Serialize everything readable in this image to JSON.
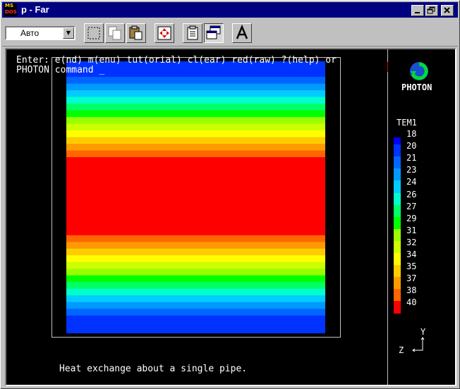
{
  "window": {
    "title": "p - Far",
    "icon_top": "MS",
    "icon_bottom": "DOS",
    "buttons": [
      "minimize-icon",
      "restore-icon",
      "close-icon"
    ]
  },
  "toolbar": {
    "font_select_value": "Авто",
    "tools": [
      "mark-icon",
      "copy-icon",
      "paste-icon",
      "fullscreen-icon",
      "properties-icon",
      "background-icon",
      "font-icon"
    ]
  },
  "console": {
    "line1": "Enter: e(nd) m(enu) tut(orial) cl(ear) red(raw) ?(help) or",
    "line2_prefix": "PHOTON",
    "line2_rest": "command _",
    "caption": "Heat exchange about a single pipe."
  },
  "photon": {
    "logo_text": "PHOTON"
  },
  "legend": {
    "title": "TEM1",
    "values": [
      "18",
      "20",
      "21",
      "23",
      "24",
      "26",
      "27",
      "29",
      "31",
      "32",
      "34",
      "35",
      "37",
      "38",
      "40"
    ],
    "colors": [
      "#0000ff",
      "#0033ff",
      "#0066ff",
      "#0099ff",
      "#00ccff",
      "#00ffcc",
      "#00ff66",
      "#00ff00",
      "#99ff00",
      "#ccff00",
      "#ffff00",
      "#ffcc00",
      "#ff9900",
      "#ff6600",
      "#ff0000"
    ]
  },
  "axes": {
    "y_label": "Y",
    "z_label": "Z"
  },
  "field": {
    "bands_top_to_bottom": [
      {
        "color": "#0033ff",
        "weight": 7
      },
      {
        "color": "#0066ff",
        "weight": 3
      },
      {
        "color": "#0099ff",
        "weight": 3
      },
      {
        "color": "#00ccff",
        "weight": 3
      },
      {
        "color": "#00ffcc",
        "weight": 3
      },
      {
        "color": "#00ff66",
        "weight": 3
      },
      {
        "color": "#00ff00",
        "weight": 3
      },
      {
        "color": "#99ff00",
        "weight": 3
      },
      {
        "color": "#ccff00",
        "weight": 3
      },
      {
        "color": "#ffff00",
        "weight": 3
      },
      {
        "color": "#ffcc00",
        "weight": 3
      },
      {
        "color": "#ff9900",
        "weight": 3
      },
      {
        "color": "#ff6600",
        "weight": 3
      },
      {
        "color": "#ff0000",
        "weight": 35
      },
      {
        "color": "#ff6600",
        "weight": 3
      },
      {
        "color": "#ff9900",
        "weight": 3
      },
      {
        "color": "#ffcc00",
        "weight": 3
      },
      {
        "color": "#ffff00",
        "weight": 3
      },
      {
        "color": "#ccff00",
        "weight": 3
      },
      {
        "color": "#99ff00",
        "weight": 3
      },
      {
        "color": "#00ff00",
        "weight": 3
      },
      {
        "color": "#00ff66",
        "weight": 3
      },
      {
        "color": "#00ffcc",
        "weight": 3
      },
      {
        "color": "#00ccff",
        "weight": 3
      },
      {
        "color": "#0099ff",
        "weight": 3
      },
      {
        "color": "#0066ff",
        "weight": 3
      },
      {
        "color": "#0033ff",
        "weight": 8
      }
    ]
  }
}
